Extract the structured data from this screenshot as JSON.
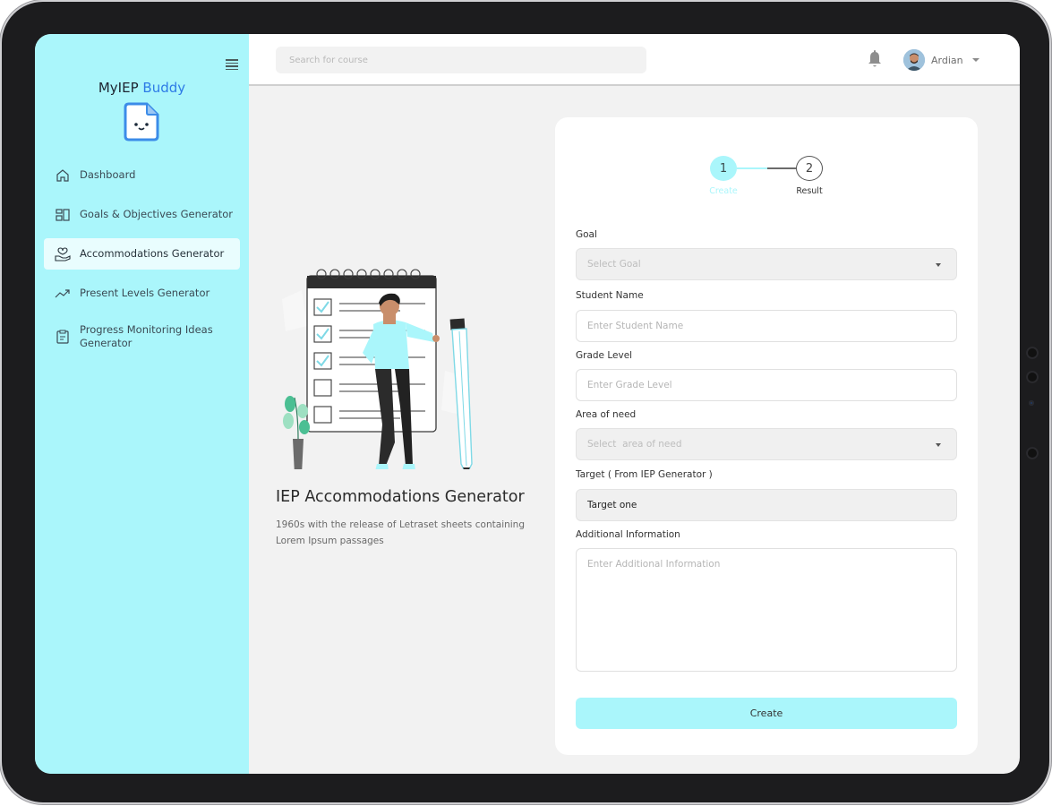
{
  "app": {
    "brand_primary": "MyIEP",
    "brand_accent": "Buddy",
    "accent_color": "#2e7be6",
    "sidebar_color": "#aaf6fb"
  },
  "sidebar": {
    "menu_icon": "hamburger-icon",
    "items": [
      {
        "label": "Dashboard",
        "icon": "home-icon",
        "active": false
      },
      {
        "label": "Goals & Objectives Generator",
        "icon": "layout-icon",
        "active": false
      },
      {
        "label": "Accommodations Generator",
        "icon": "hand-heart-icon",
        "active": true
      },
      {
        "label": "Present Levels Generator",
        "icon": "trending-up-icon",
        "active": false
      },
      {
        "label": "Progress Monitoring Ideas Generator",
        "icon": "clipboard-icon",
        "active": false
      }
    ]
  },
  "topbar": {
    "search_placeholder": "Search for course",
    "notification_icon": "bell-icon",
    "user_name": "Ardian"
  },
  "intro": {
    "title": "IEP Accommodations Generator",
    "description": "1960s with the release of Letraset sheets containing Lorem Ipsum passages"
  },
  "stepper": {
    "steps": [
      {
        "number": "1",
        "label": "Create",
        "active": true
      },
      {
        "number": "2",
        "label": "Result",
        "active": false
      }
    ]
  },
  "form": {
    "goal": {
      "label": "Goal",
      "placeholder": "Select Goal"
    },
    "student_name": {
      "label": "Student Name",
      "placeholder": "Enter Student Name"
    },
    "grade_level": {
      "label": "Grade Level",
      "placeholder": "Enter Grade Level"
    },
    "area_of_need": {
      "label": "Area of need",
      "placeholder": "Select  area of need"
    },
    "target": {
      "label": "Target ( From IEP Generator )",
      "value": "Target one"
    },
    "additional_info": {
      "label": "Additional Information",
      "placeholder": "Enter Additional Information"
    },
    "submit_label": "Create"
  }
}
